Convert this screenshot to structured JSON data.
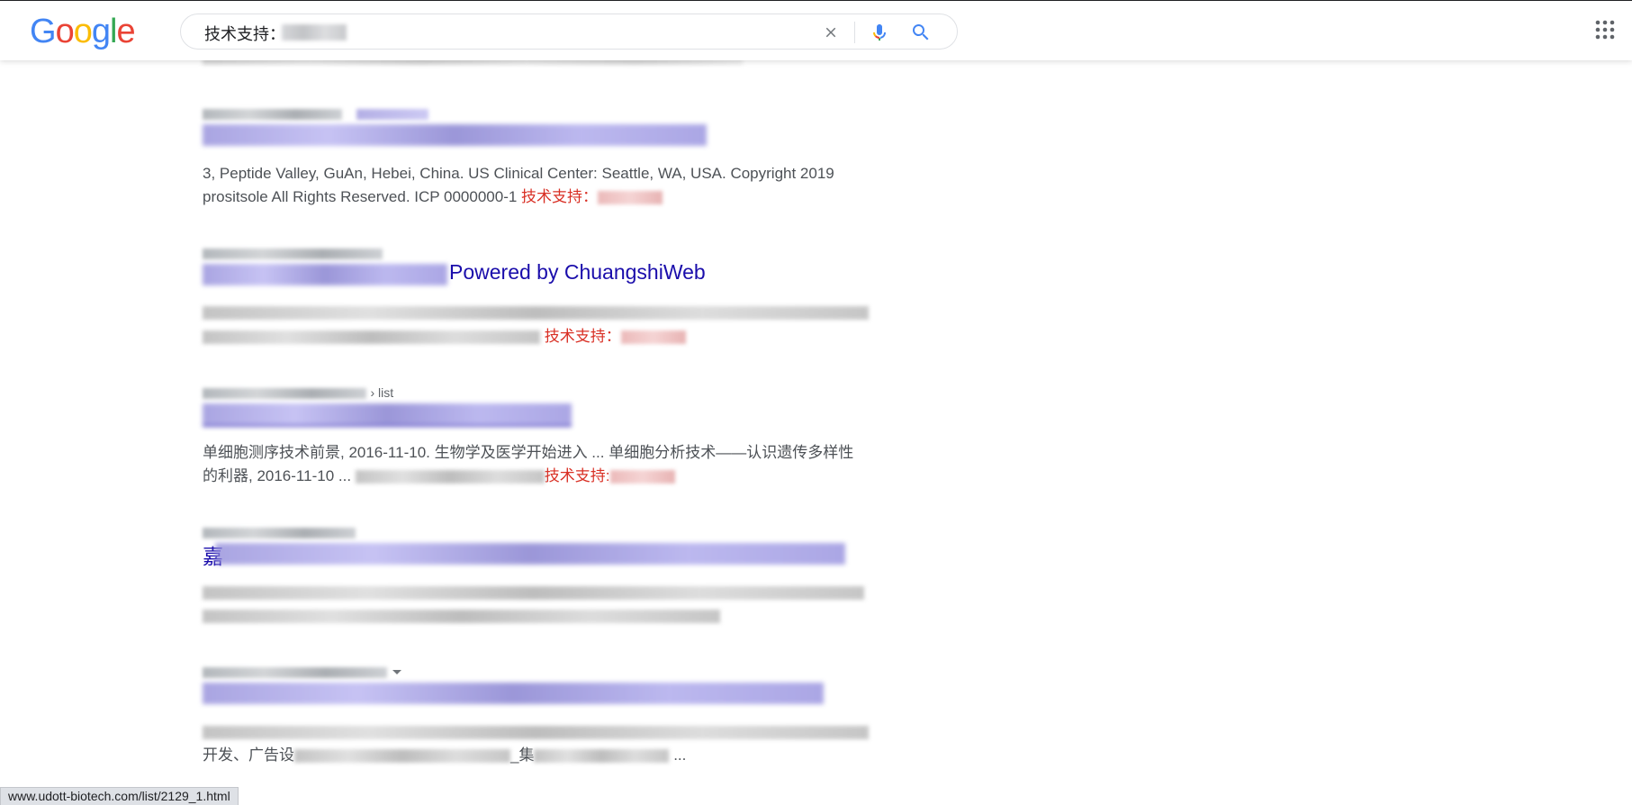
{
  "header": {
    "logo_letters": [
      {
        "ch": "G",
        "color": "#4285F4"
      },
      {
        "ch": "o",
        "color": "#EA4335"
      },
      {
        "ch": "o",
        "color": "#FBBC05"
      },
      {
        "ch": "g",
        "color": "#4285F4"
      },
      {
        "ch": "l",
        "color": "#34A853"
      },
      {
        "ch": "e",
        "color": "#EA4335"
      }
    ],
    "search_query": "技术支持：",
    "icons": {
      "clear": "close-icon",
      "mic": "microphone-icon",
      "search": "search-icon",
      "apps": "apps-grid-icon"
    }
  },
  "results": [
    {
      "title_visible": "",
      "snippet_lines": [
        "3, Peptide Valley, GuAn, Hebei, China. US Clinical Center: Seattle, WA, USA. Copyright 2019",
        "prositsole All Rights Reserved. ICP 0000000-1 "
      ],
      "highlight": "技术支持："
    },
    {
      "title_visible": "Powered by ChuangshiWeb",
      "highlight": "技术支持："
    },
    {
      "url_suffix": "› list",
      "snippet_lines": [
        "单细胞测序技术前景, 2016-11-10. 生物学及医学开始进入 ... 单细胞分析技术——认识遗传多样性",
        "的利器, 2016-11-10 ... "
      ],
      "highlight": "技术支持:"
    },
    {
      "title_prefix": "嘉"
    },
    {
      "url_visible": "company.zhaopin.com › ...",
      "snippet_line2_visible": "开发、广告设",
      "snippet_line2_mid": "_集",
      "snippet_line2_end": " ..."
    }
  ],
  "status_bar": {
    "url": "www.udott-biotech.com/list/2129_1.html"
  },
  "colors": {
    "link": "#1a0dab",
    "highlight": "#d93025",
    "snippet": "#4d5156",
    "icon_blue": "#4285F4"
  }
}
